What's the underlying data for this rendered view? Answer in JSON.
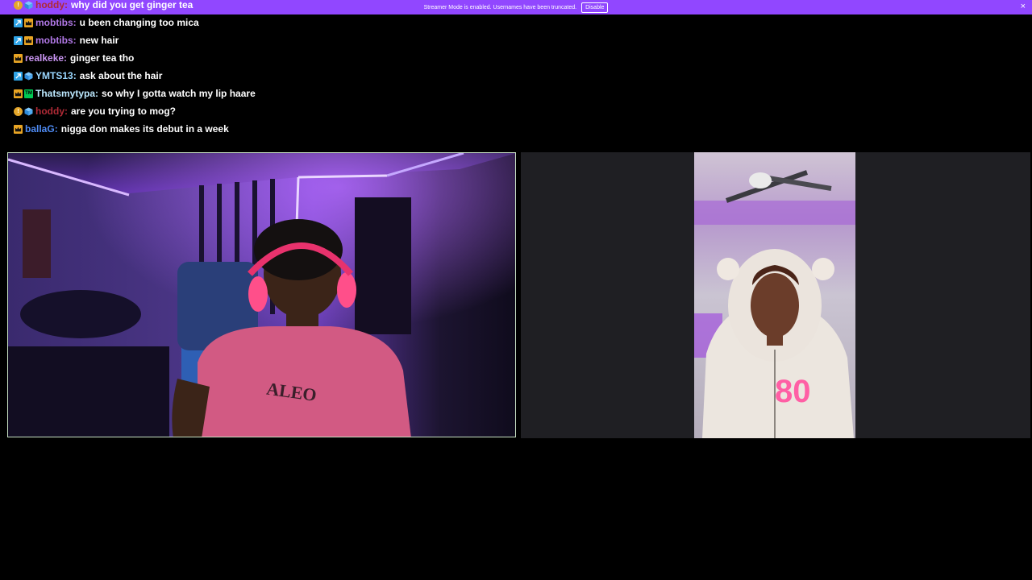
{
  "banner": {
    "message": "Streamer Mode is enabled. Usernames have been truncated.",
    "disable_label": "Disable",
    "close_glyph": "×"
  },
  "chat": [
    {
      "badges": [
        "coin-icon",
        "cube-icon"
      ],
      "user": "hoddy",
      "color": "#b02a36",
      "text": "why did you get ginger tea"
    },
    {
      "badges": [
        "vip-icon",
        "crown-icon"
      ],
      "user": "mobtibs",
      "color": "#b178e6",
      "text": "u been changing too mica"
    },
    {
      "badges": [
        "vip-icon",
        "crown-icon"
      ],
      "user": "mobtibs",
      "color": "#b178e6",
      "text": "new hair"
    },
    {
      "badges": [
        "crown-icon"
      ],
      "user": "realkeke",
      "color": "#c894f0",
      "text": "ginger tea tho"
    },
    {
      "badges": [
        "vip-icon",
        "cube-icon"
      ],
      "user": "YMTS13",
      "color": "#9ad7ff",
      "text": "ask about the hair"
    },
    {
      "badges": [
        "crown-icon",
        "glitch-icon"
      ],
      "user": "Thatsmytypa",
      "color": "#bde9ff",
      "text": "so why I gotta watch my lip haare"
    },
    {
      "badges": [
        "coin-icon",
        "cube-icon"
      ],
      "user": "hoddy",
      "color": "#b02a36",
      "text": "are you trying to mog?"
    },
    {
      "badges": [
        "crown-icon"
      ],
      "user": "ballaG",
      "color": "#4f8cf5",
      "text": "nigga don makes its debut in a week"
    }
  ],
  "colors": {
    "banner": "#9147ff",
    "active_tile_border": "#c9e2c4",
    "background": "#000000"
  }
}
